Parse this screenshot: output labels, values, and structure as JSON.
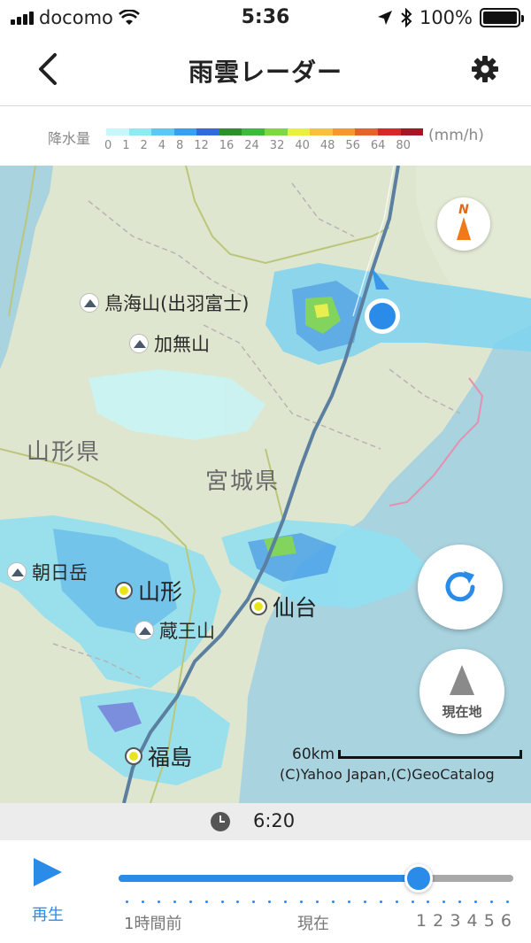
{
  "status_bar": {
    "carrier": "docomo",
    "time": "5:36",
    "battery": "100%"
  },
  "nav": {
    "title": "雨雲レーダー"
  },
  "legend": {
    "label": "降水量",
    "unit": "(mm/h)",
    "ticks": [
      "0",
      "1",
      "2",
      "4",
      "8",
      "12",
      "16",
      "24",
      "32",
      "40",
      "48",
      "56",
      "64",
      "80"
    ],
    "colors": [
      "#c8f6fb",
      "#8feaf2",
      "#5fc8f2",
      "#3aa0ee",
      "#3468e0",
      "#2f8f2f",
      "#3fb83f",
      "#7fd843",
      "#e8f03a",
      "#f6c23a",
      "#f29a2a",
      "#e8602a",
      "#d8262a",
      "#a81424"
    ]
  },
  "map": {
    "places": {
      "chokai": "鳥海山(出羽富士)",
      "kamuro": "加無山",
      "asahi": "朝日岳",
      "zao": "蔵王山",
      "yamagata_city": "山形",
      "sendai": "仙台",
      "fukushima": "福島"
    },
    "prefectures": {
      "yamagata": "山形県",
      "miyagi": "宮城県"
    },
    "compass_label": "N",
    "locate_label": "現在地",
    "scale_label": "60km",
    "copyright": "(C)Yahoo Japan,(C)GeoCatalog"
  },
  "timebar": {
    "time": "6:20"
  },
  "playback": {
    "play_label": "再生",
    "progress_fraction": 0.76,
    "label_start": "1時間前",
    "label_now": "現在",
    "hours": [
      "1",
      "2",
      "3",
      "4",
      "5",
      "6"
    ]
  }
}
